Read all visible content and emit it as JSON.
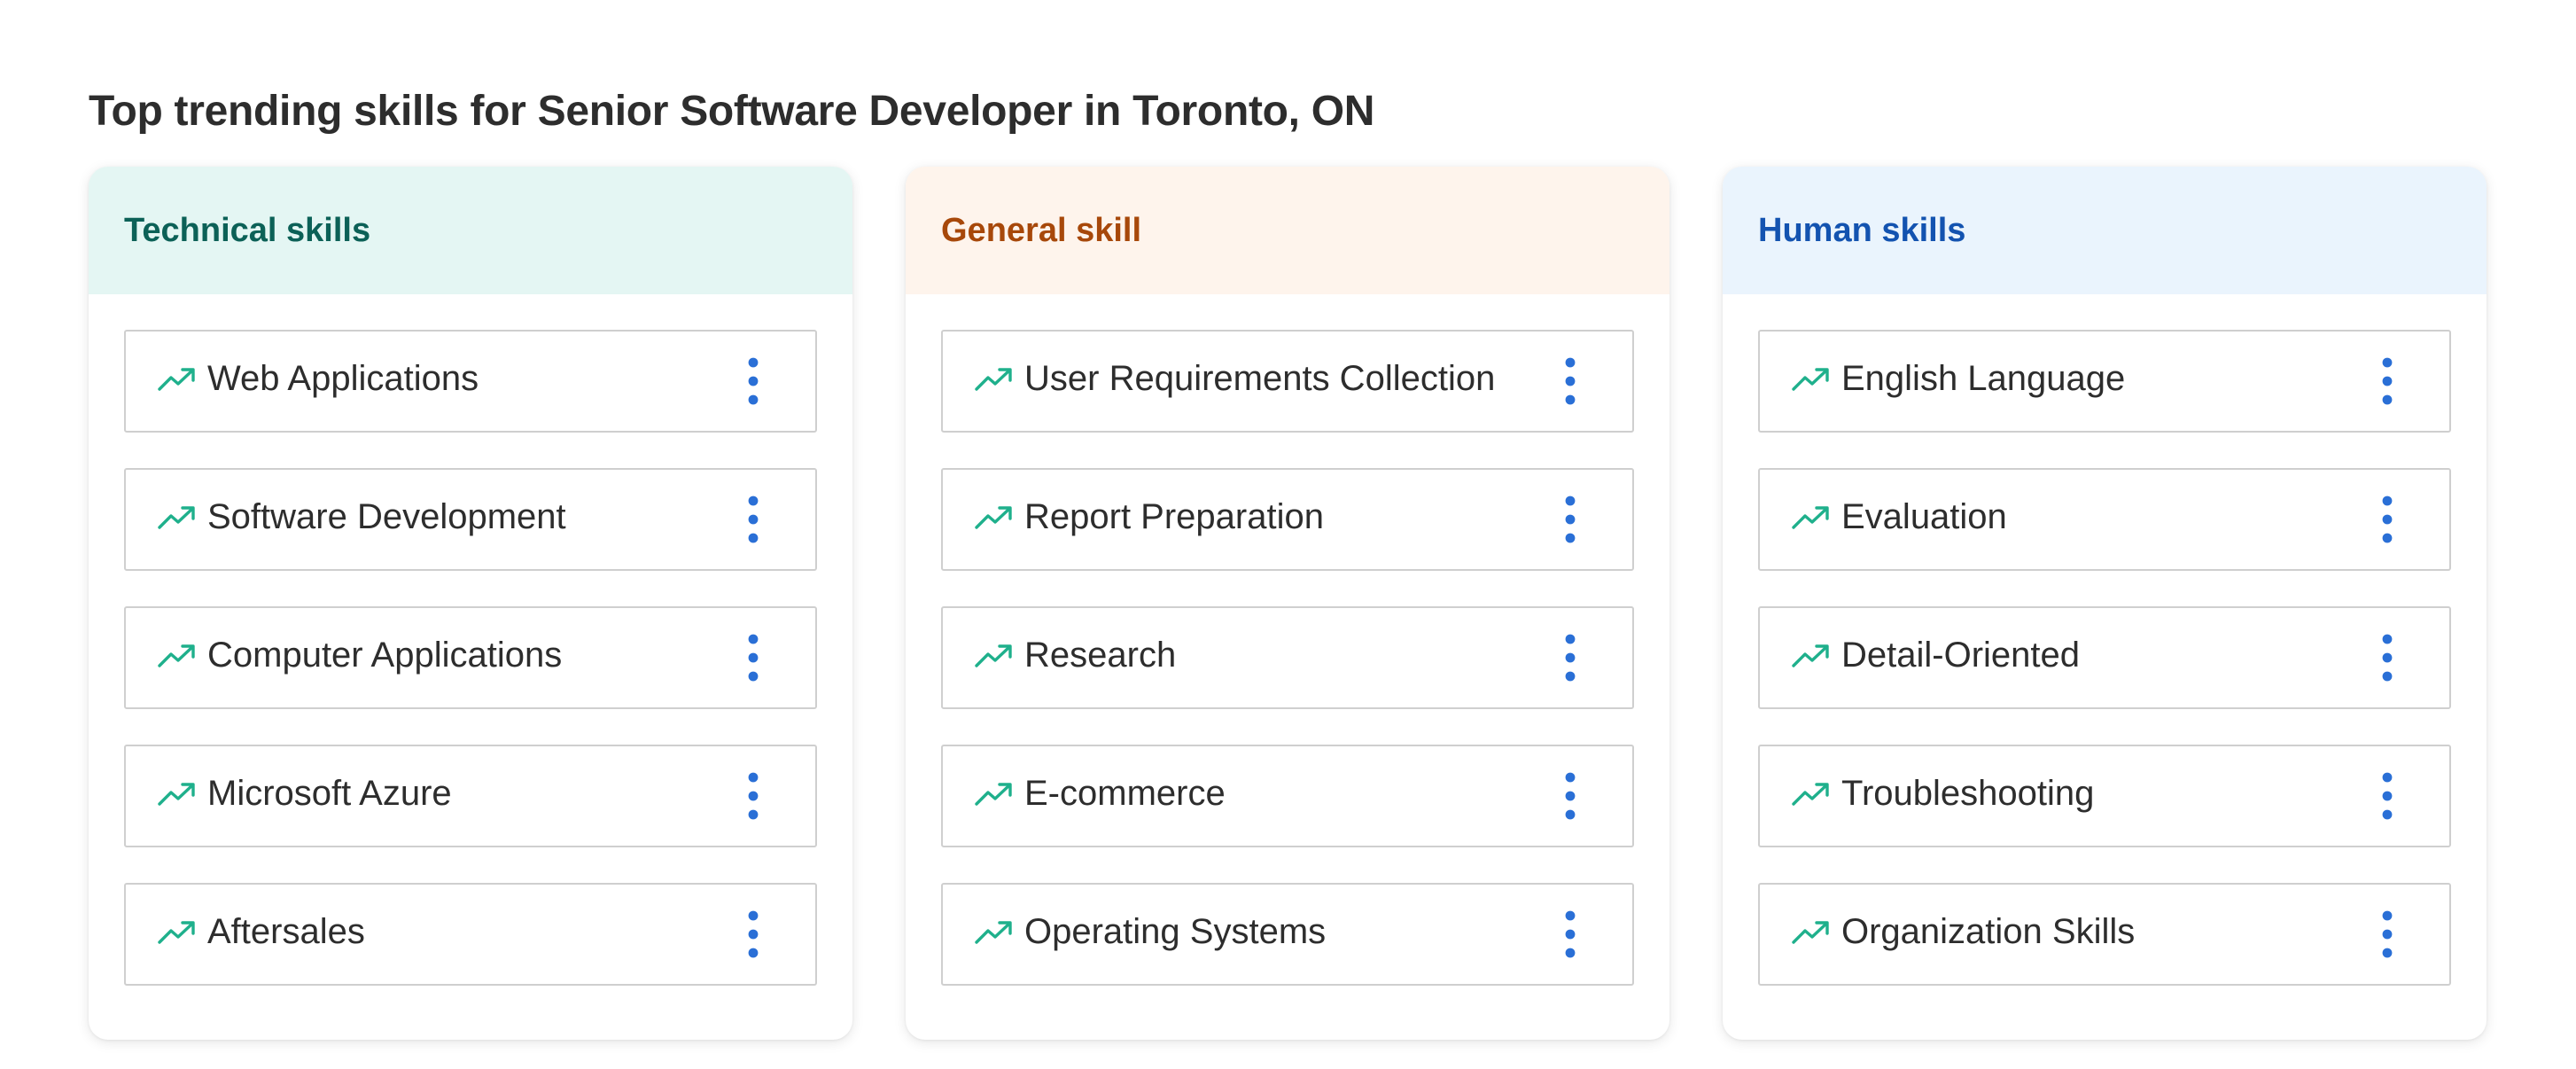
{
  "page": {
    "title": "Top trending skills for Senior Software Developer in Toronto, ON"
  },
  "colors": {
    "trend_icon": "#1fb08c",
    "more_icon": "#2a6fd6",
    "technical_header_bg": "#e4f6f3",
    "technical_title": "#0c6157",
    "general_header_bg": "#fef4ec",
    "general_title": "#a7480a",
    "human_header_bg": "#eaf4fd",
    "human_title": "#1353b0"
  },
  "icons": {
    "trend": "trending-up-icon",
    "more": "more-vertical-icon"
  },
  "cards": [
    {
      "title": "Technical skills",
      "skills": [
        "Web Applications",
        "Software Development",
        "Computer Applications",
        "Microsoft Azure",
        "Aftersales"
      ]
    },
    {
      "title": "General skill",
      "skills": [
        "User Requirements Collection",
        "Report Preparation",
        "Research",
        "E-commerce",
        "Operating Systems"
      ]
    },
    {
      "title": "Human skills",
      "skills": [
        "English Language",
        "Evaluation",
        "Detail-Oriented",
        "Troubleshooting",
        "Organization Skills"
      ]
    }
  ]
}
